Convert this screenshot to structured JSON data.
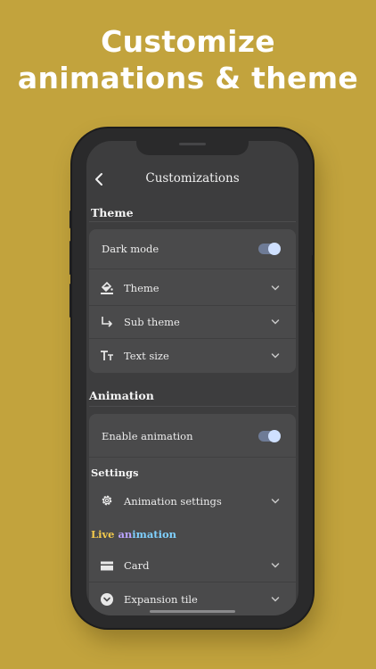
{
  "headline": {
    "line1": "Customize",
    "line2": "animations & theme"
  },
  "appbar": {
    "title": "Customizations",
    "back_icon": "chevron-left-icon"
  },
  "theme_section": {
    "title": "Theme",
    "dark_mode": {
      "label": "Dark mode",
      "enabled": true
    },
    "items": [
      {
        "label": "Theme",
        "icon": "paint-bucket-icon"
      },
      {
        "label": "Sub theme",
        "icon": "subdirectory-arrow-icon"
      },
      {
        "label": "Text size",
        "icon": "text-size-icon"
      }
    ]
  },
  "animation_section": {
    "title": "Animation",
    "enable": {
      "label": "Enable animation",
      "enabled": true
    },
    "settings_heading": "Settings",
    "settings_item": {
      "label": "Animation settings",
      "icon": "gear-icon"
    },
    "live_heading": {
      "part1": "Live",
      "part2": " an",
      "part3": "imation"
    },
    "live_colors": {
      "part1": "#f2c94c",
      "part2": "#b9a3ff",
      "part3": "#7fd0ff"
    },
    "items": [
      {
        "label": "Card",
        "icon": "card-icon"
      },
      {
        "label": "Expansion tile",
        "icon": "expand-circle-icon"
      }
    ]
  },
  "colors": {
    "background": "#c2a33d",
    "toggle_track": "#6e7b96",
    "toggle_knob": "#cfe0ff"
  }
}
